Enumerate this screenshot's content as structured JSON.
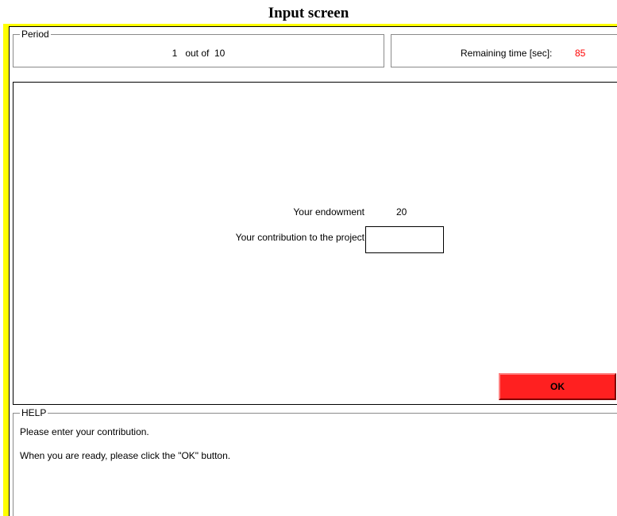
{
  "screen_title": "Input screen",
  "period": {
    "legend": "Period",
    "text": "1   out of  10"
  },
  "timer": {
    "label": "Remaining time [sec]:",
    "value": "85",
    "value_color": "#ff0000"
  },
  "main": {
    "endowment_label": "Your endowment",
    "endowment_value": "20",
    "contribution_label": "Your contribution to the project",
    "contribution_value": ""
  },
  "ok_button": {
    "label": "OK",
    "color": "#ff2020"
  },
  "help": {
    "legend": "HELP",
    "line1": "Please enter your contribution.",
    "line2": "When you are ready, please click the \"OK\" button."
  },
  "colors": {
    "frame_border": "#ffff00"
  }
}
